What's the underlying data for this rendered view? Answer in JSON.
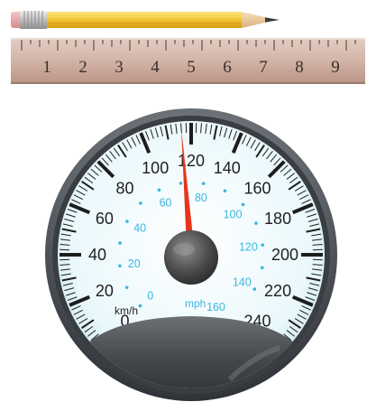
{
  "ruler": {
    "numbers": [
      "1",
      "2",
      "3",
      "4",
      "5",
      "6",
      "7",
      "8",
      "9"
    ],
    "color": "#c9a89a"
  },
  "pencil": {
    "body_color": "#f2c431",
    "eraser_color": "#e8a3a6"
  },
  "speedometer": {
    "unit_kmh": "km/h",
    "unit_mph": "mph",
    "kmh_labels": [
      "0",
      "20",
      "40",
      "60",
      "80",
      "100",
      "120",
      "140",
      "160",
      "180",
      "200",
      "220",
      "240"
    ],
    "mph_labels": [
      "0",
      "20",
      "40",
      "60",
      "80",
      "100",
      "120",
      "140",
      "160"
    ],
    "kmh_min": 0,
    "kmh_max": 240,
    "mph_max": 160,
    "needle_value_kmh": 116,
    "needle_color": "#e8341c",
    "dial_color": "#e8f7fb",
    "mph_color": "#3ab7e0"
  }
}
